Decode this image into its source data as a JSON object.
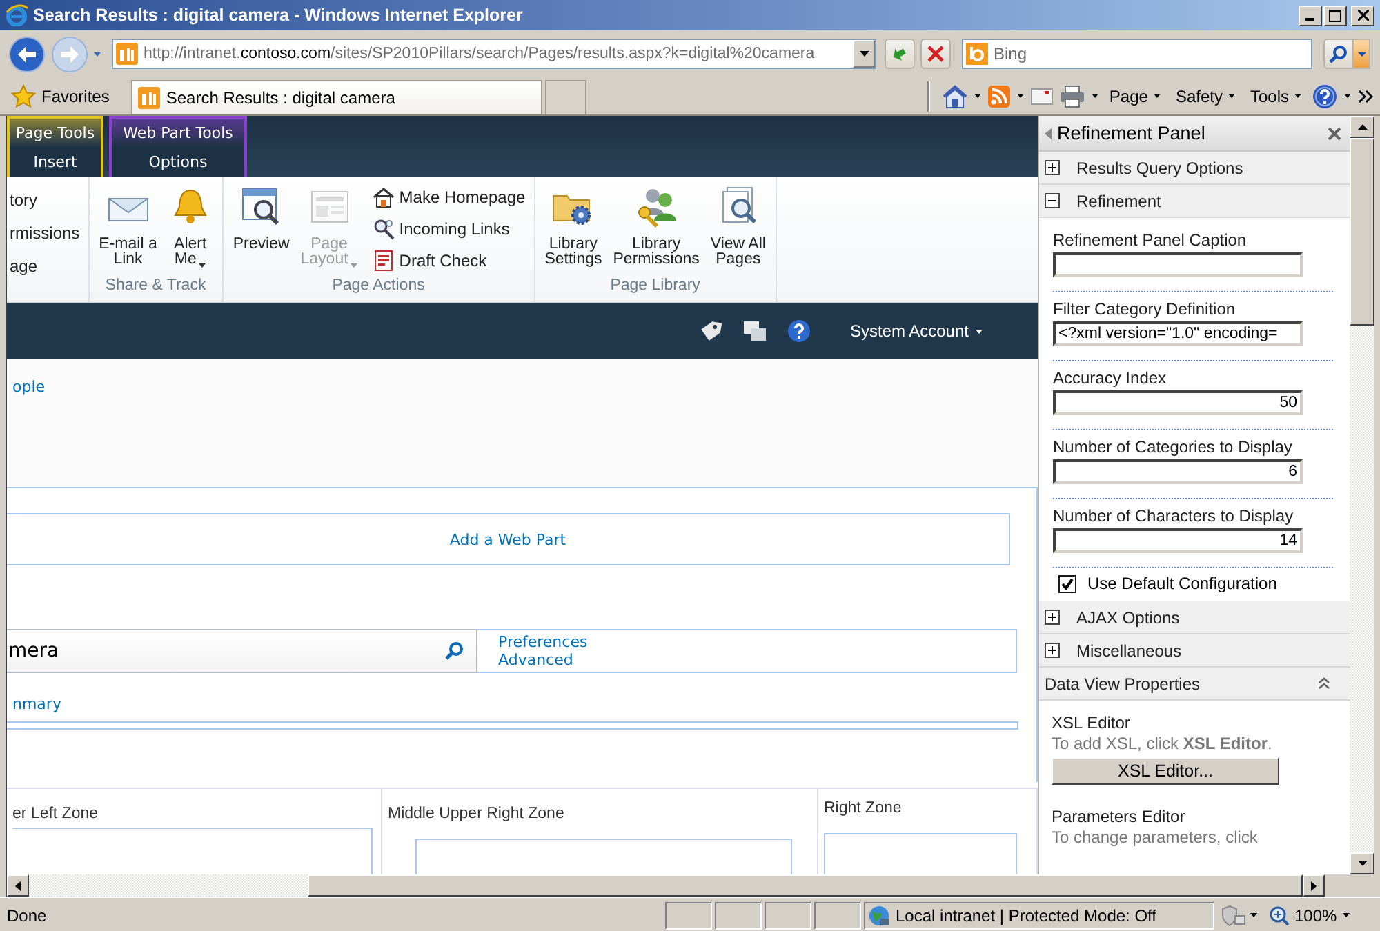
{
  "window": {
    "title": "Search Results : digital camera - Windows Internet Explorer"
  },
  "address_bar": {
    "url_parts": [
      {
        "text": "http://intranet.",
        "emphasis": false
      },
      {
        "text": "contoso.com",
        "emphasis": true
      },
      {
        "text": "/sites/SP2010Pillars/search/Pages/results.aspx?k=digital%20camera",
        "emphasis": false
      }
    ]
  },
  "search_box": {
    "placeholder": "Bing"
  },
  "favorites": {
    "label": "Favorites"
  },
  "browser_tabs": [
    {
      "title": "Search Results : digital camera",
      "selected": true
    }
  ],
  "command_bar": [
    {
      "kind": "home"
    },
    {
      "kind": "feeds"
    },
    {
      "kind": "mail"
    },
    {
      "kind": "print"
    },
    {
      "kind": "menu",
      "label": "Page"
    },
    {
      "kind": "menu",
      "label": "Safety"
    },
    {
      "kind": "menu",
      "label": "Tools"
    },
    {
      "kind": "help"
    }
  ],
  "ribbon": {
    "contextual_tabs": [
      {
        "group": "Page Tools",
        "tab": "Insert",
        "color": "#e2c21c"
      },
      {
        "group": "Web Part Tools",
        "tab": "Options",
        "color": "#8a3fd0"
      }
    ],
    "groups": [
      {
        "items": [
          {
            "kind": "row",
            "lines": [
              "tory"
            ],
            "disabled": false
          },
          {
            "kind": "row",
            "lines": [
              "rmissions"
            ],
            "disabled": false
          },
          {
            "kind": "row",
            "lines": [
              "age"
            ],
            "disabled": false
          }
        ]
      },
      {
        "label": "Share & Track",
        "items": [
          {
            "kind": "large",
            "lines": [
              "E-mail a",
              "Link"
            ],
            "dropdown": false,
            "disabled": false
          },
          {
            "kind": "large",
            "lines": [
              "Alert",
              "Me"
            ],
            "dropdown": true,
            "disabled": false
          }
        ]
      },
      {
        "label": "Page Actions",
        "items": [
          {
            "kind": "large",
            "lines": [
              "Preview"
            ],
            "dropdown": false,
            "disabled": false
          },
          {
            "kind": "large",
            "lines": [
              "Page",
              "Layout"
            ],
            "dropdown": true,
            "disabled": true
          },
          {
            "kind": "small",
            "lines": [
              "Make Homepage"
            ],
            "disabled": false
          },
          {
            "kind": "small",
            "lines": [
              "Incoming Links"
            ],
            "disabled": false
          },
          {
            "kind": "small",
            "lines": [
              "Draft Check"
            ],
            "disabled": false
          }
        ]
      },
      {
        "label": "Page Library",
        "items": [
          {
            "kind": "large",
            "lines": [
              "Library",
              "Settings"
            ],
            "dropdown": false,
            "disabled": false
          },
          {
            "kind": "large",
            "lines": [
              "Library",
              "Permissions"
            ],
            "dropdown": false,
            "disabled": false
          },
          {
            "kind": "large",
            "lines": [
              "View All",
              "Pages"
            ],
            "dropdown": false,
            "disabled": false
          }
        ]
      }
    ]
  },
  "top_bar": {
    "icons": [
      {
        "kind": "tag"
      },
      {
        "kind": "notes"
      },
      {
        "kind": "help"
      }
    ],
    "user": "System Account"
  },
  "page": {
    "nav_link": "ople",
    "add_web_part": "Add a Web Part",
    "search": {
      "value": "mera"
    },
    "search_links": [
      "Preferences",
      "Advanced"
    ],
    "summary_link": "nmary",
    "zones": [
      {
        "title": "er Left Zone"
      },
      {
        "title": "Middle Upper Right Zone"
      },
      {
        "title": "Right Zone"
      }
    ]
  },
  "tool_pane": {
    "title": "Refinement Panel",
    "sections": [
      {
        "title": "Results Query Options",
        "expanded": false
      },
      {
        "title": "Refinement",
        "expanded": true,
        "fields": [
          {
            "label": "Refinement Panel Caption",
            "kind": "text"
          },
          {
            "label": "Filter Category Definition",
            "kind": "text",
            "value": "<?xml version=\"1.0\" encoding="
          },
          {
            "label": "Accuracy Index",
            "kind": "number",
            "value": "50"
          },
          {
            "label": "Number of Categories to Display",
            "kind": "number",
            "value": "6"
          },
          {
            "label": "Number of Characters to Display",
            "kind": "number",
            "value": "14"
          }
        ],
        "checkbox": {
          "label": "Use Default Configuration",
          "checked": true
        }
      },
      {
        "title": "AJAX Options",
        "expanded": false
      },
      {
        "title": "Miscellaneous",
        "expanded": false
      }
    ],
    "data_view": {
      "title": "Data View Properties",
      "expanded": true,
      "xsl_title": "XSL Editor",
      "xsl_hint": "To add XSL, click **XSL Editor**.",
      "xsl_button": "XSL Editor...",
      "params_title": "Parameters Editor",
      "params_hint": "To change parameters, click"
    }
  },
  "status_bar": {
    "text": "Done",
    "zone": "Local intranet | Protected Mode: Off",
    "zoom": "100%"
  }
}
